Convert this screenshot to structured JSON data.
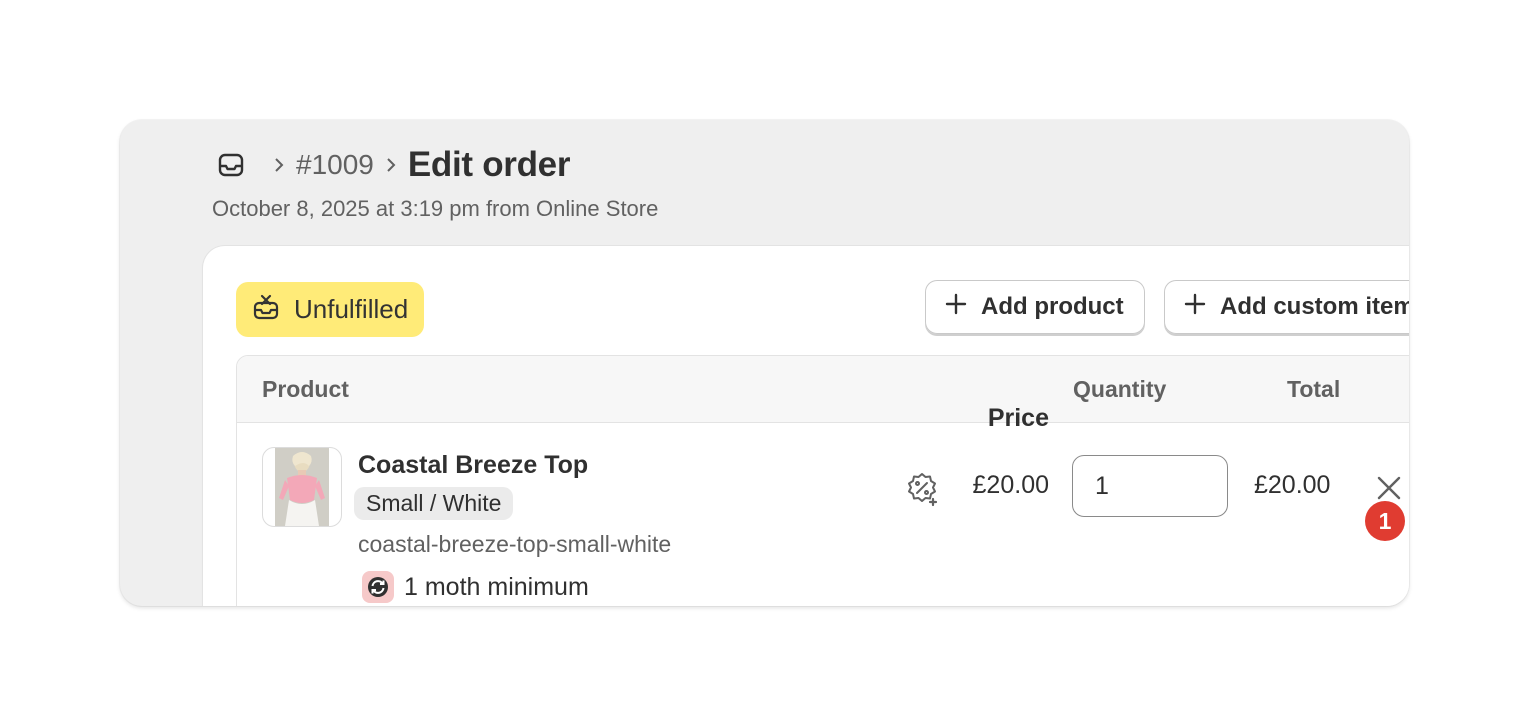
{
  "header": {
    "order_number": "#1009",
    "title": "Edit order",
    "subtitle": "October 8, 2025 at 3:19 pm from Online Store"
  },
  "status": {
    "label": "Unfulfilled",
    "color": "#ffeb78"
  },
  "actions": {
    "add_product": "Add product",
    "add_custom_item": "Add custom item"
  },
  "table": {
    "columns": {
      "product": "Product",
      "price": "Price",
      "quantity": "Quantity",
      "total": "Total"
    },
    "rows": [
      {
        "name": "Coastal Breeze Top",
        "variant": "Small / White",
        "sku": "coastal-breeze-top-small-white",
        "plan": "1 moth minimum",
        "price": "£20.00",
        "quantity": "1",
        "total": "£20.00"
      }
    ]
  },
  "annotation": {
    "badge": "1",
    "color": "#e03c31"
  },
  "icons": [
    "inbox-icon",
    "chevron-right-icon",
    "unfulfilled-icon",
    "plus-icon",
    "discount-icon",
    "subscription-icon",
    "close-icon"
  ]
}
